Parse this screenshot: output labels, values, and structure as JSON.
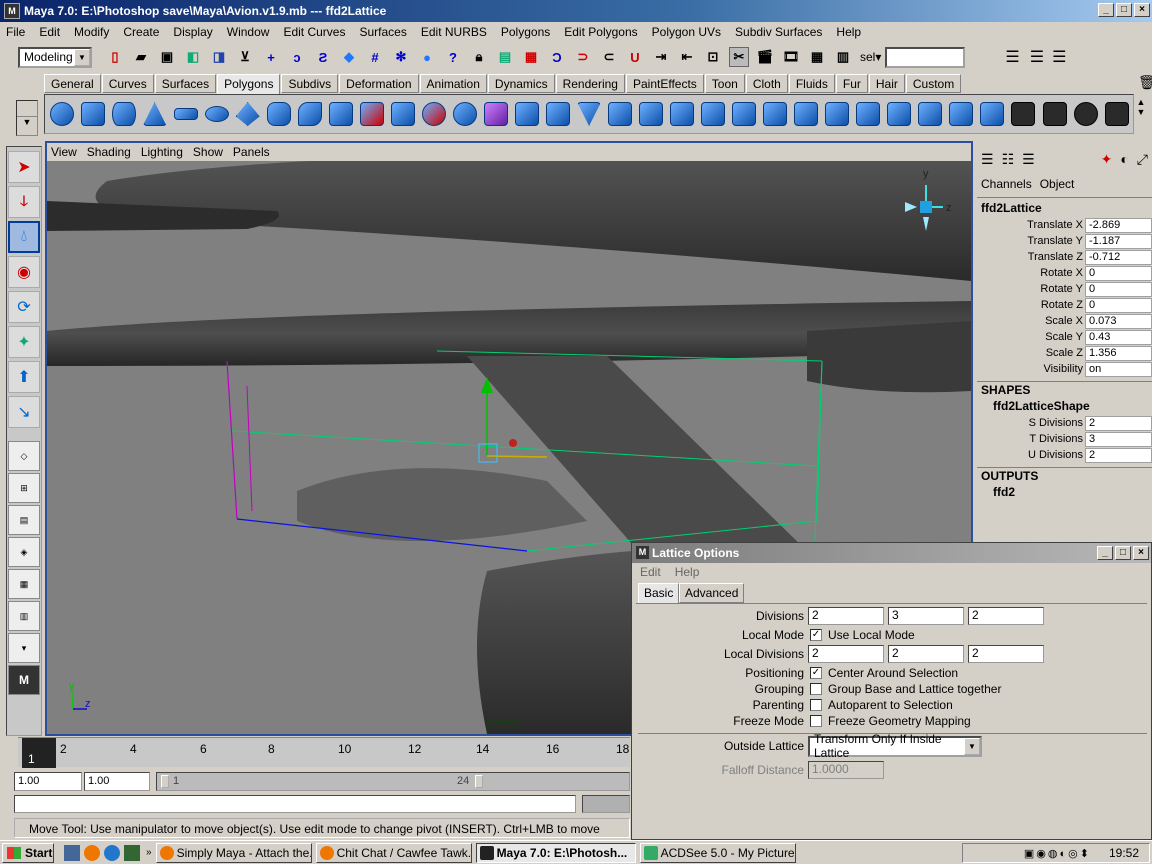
{
  "window": {
    "title": "Maya 7.0: E:\\Photoshop save\\Maya\\Avion.v1.9.mb  ---  ffd2Lattice"
  },
  "menu": [
    "File",
    "Edit",
    "Modify",
    "Create",
    "Display",
    "Window",
    "Edit Curves",
    "Surfaces",
    "Edit NURBS",
    "Polygons",
    "Edit Polygons",
    "Polygon UVs",
    "Subdiv Surfaces",
    "Help"
  ],
  "toolbar": {
    "mode": "Modeling",
    "sel_label": "sel▾"
  },
  "shelf_tabs": [
    "General",
    "Curves",
    "Surfaces",
    "Polygons",
    "Subdivs",
    "Deformation",
    "Animation",
    "Dynamics",
    "Rendering",
    "PaintEffects",
    "Toon",
    "Cloth",
    "Fluids",
    "Fur",
    "Hair",
    "Custom"
  ],
  "shelf_active": "Polygons",
  "viewport": {
    "menu": [
      "View",
      "Shading",
      "Lighting",
      "Show",
      "Panels"
    ],
    "camera": "persp",
    "axis_y": "y",
    "axis_z": "z"
  },
  "channels": {
    "tabs": [
      "Channels",
      "Object"
    ],
    "node": "ffd2Lattice",
    "attrs": [
      {
        "label": "Translate X",
        "value": "-2.869"
      },
      {
        "label": "Translate Y",
        "value": "-1.187"
      },
      {
        "label": "Translate Z",
        "value": "-0.712"
      },
      {
        "label": "Rotate X",
        "value": "0"
      },
      {
        "label": "Rotate Y",
        "value": "0"
      },
      {
        "label": "Rotate Z",
        "value": "0"
      },
      {
        "label": "Scale X",
        "value": "0.073"
      },
      {
        "label": "Scale Y",
        "value": "0.43"
      },
      {
        "label": "Scale Z",
        "value": "1.356"
      },
      {
        "label": "Visibility",
        "value": "on"
      }
    ],
    "shapes_header": "SHAPES",
    "shape_node": "ffd2LatticeShape",
    "shape_attrs": [
      {
        "label": "S Divisions",
        "value": "2"
      },
      {
        "label": "T Divisions",
        "value": "3"
      },
      {
        "label": "U Divisions",
        "value": "2"
      }
    ],
    "outputs_header": "OUTPUTS",
    "output_node": "ffd2"
  },
  "timeline": {
    "ticks": [
      "1",
      "2",
      "4",
      "6",
      "8",
      "10",
      "12",
      "14",
      "16",
      "18"
    ],
    "current": "1"
  },
  "range": {
    "start": "1.00",
    "start2": "1.00",
    "slider_start": "1",
    "slider_end": "24"
  },
  "helpline": "Move Tool: Use manipulator to move object(s). Use edit mode to change pivot (INSERT).  Ctrl+LMB to move perpendicular.",
  "dialog": {
    "title": "Lattice Options",
    "menu": [
      "Edit",
      "Help"
    ],
    "tabs": [
      "Basic",
      "Advanced"
    ],
    "divisions_label": "Divisions",
    "divisions": [
      "2",
      "3",
      "2"
    ],
    "local_mode_label": "Local Mode",
    "local_mode_text": "Use Local Mode",
    "local_div_label": "Local Divisions",
    "local_divisions": [
      "2",
      "2",
      "2"
    ],
    "positioning_label": "Positioning",
    "positioning_text": "Center Around Selection",
    "grouping_label": "Grouping",
    "grouping_text": "Group Base and Lattice together",
    "parenting_label": "Parenting",
    "parenting_text": "Autoparent to Selection",
    "freeze_label": "Freeze Mode",
    "freeze_text": "Freeze Geometry Mapping",
    "outside_label": "Outside Lattice",
    "outside_value": "Transform Only If Inside Lattice",
    "falloff_label": "Falloff Distance",
    "falloff_value": "1.0000"
  },
  "taskbar": {
    "start": "Start",
    "tasks": [
      "Simply Maya - Attach the...",
      "Chit Chat / Cawfee Tawk...",
      "Maya 7.0: E:\\Photosh...",
      "ACDSee 5.0 - My Pictures"
    ],
    "clock": "19:52"
  }
}
